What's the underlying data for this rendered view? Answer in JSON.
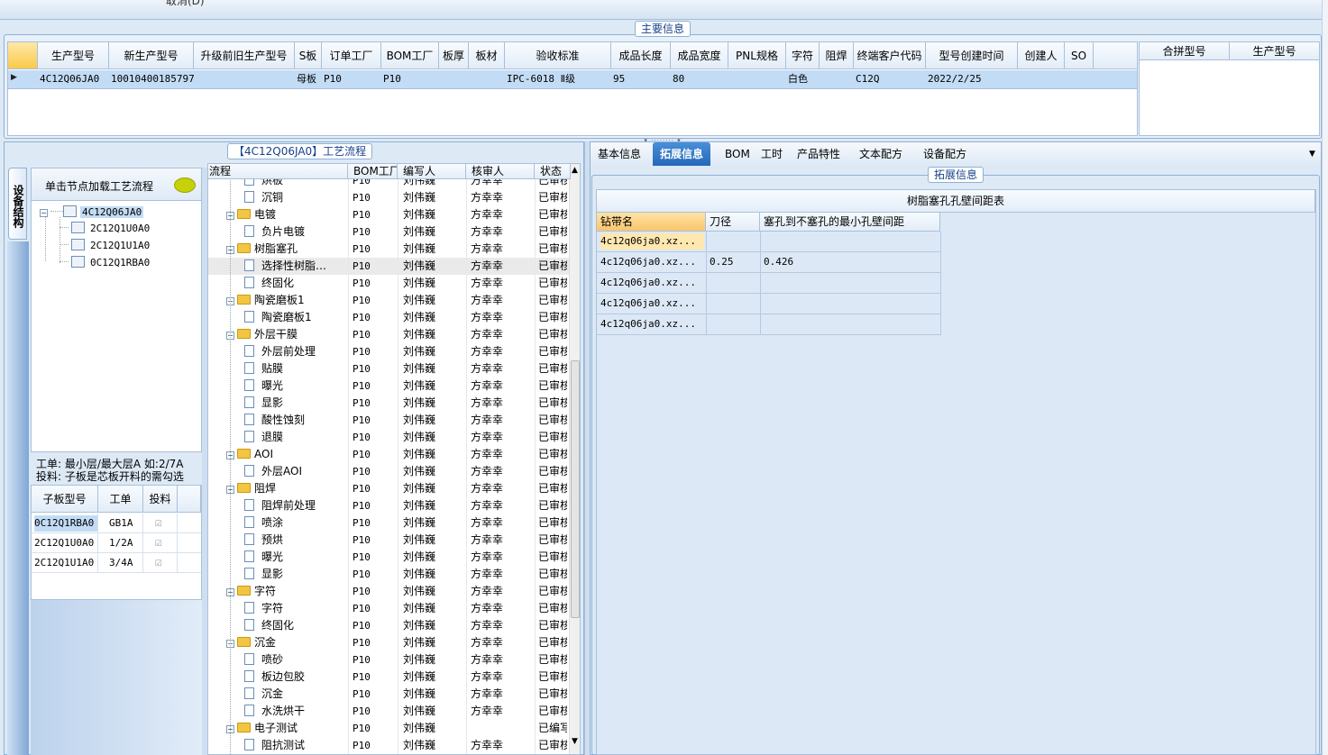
{
  "top_strip": {
    "text": "取消(D)"
  },
  "main_info": {
    "caption": "主要信息",
    "columns": [
      "生产型号",
      "新生产型号",
      "升级前旧生产型号",
      "S板",
      "订单工厂",
      "BOM工厂",
      "板厚",
      "板材",
      "验收标准",
      "成品长度",
      "成品宽度",
      "PNL规格",
      "字符",
      "阻焊",
      "终端客户代码",
      "型号创建时间",
      "创建人",
      "SO"
    ],
    "row": [
      "4C12Q06JA0",
      "10010400185797",
      "",
      "母板",
      "P10",
      "P10",
      "",
      "",
      "IPC-6018 Ⅱ级",
      "95",
      "80",
      "",
      "白色",
      "",
      "C12Q",
      "2022/2/25",
      "",
      ""
    ],
    "side_columns": [
      "合拼型号",
      "生产型号"
    ]
  },
  "left_panel": {
    "vertical_tab": "设备结构",
    "hint": "单击节点加载工艺流程",
    "tree": {
      "root": "4C12Q06JA0",
      "children": [
        "2C12Q1U0A0",
        "2C12Q1U1A0",
        "0C12Q1RBA0"
      ]
    },
    "note1": "工单: 最小层/最大层A 如:2/7A",
    "note2": "投料: 子板是芯板开料的需勾选",
    "sub_table": {
      "columns": [
        "子板型号",
        "工单",
        "投料"
      ],
      "rows": [
        {
          "model": "0C12Q1RBA0",
          "order": "GB1A",
          "feed": "☑"
        },
        {
          "model": "2C12Q1U0A0",
          "order": "1/2A",
          "feed": "☑"
        },
        {
          "model": "2C12Q1U1A0",
          "order": "3/4A",
          "feed": "☑"
        }
      ]
    }
  },
  "process": {
    "caption": "【4C12Q06JA0】工艺流程",
    "columns": [
      "流程",
      "BOM工厂",
      "编写人",
      "核审人",
      "状态"
    ],
    "rows": [
      {
        "name": "烘板",
        "type": "doc",
        "bom": "P10",
        "writer": "刘伟巍",
        "reviewer": "方幸幸",
        "status": "已审核"
      },
      {
        "name": "沉铜",
        "type": "doc",
        "bom": "P10",
        "writer": "刘伟巍",
        "reviewer": "方幸幸",
        "status": "已审核"
      },
      {
        "name": "电镀",
        "type": "folder",
        "bom": "P10",
        "writer": "刘伟巍",
        "reviewer": "方幸幸",
        "status": "已审核"
      },
      {
        "name": "负片电镀",
        "type": "doc",
        "bom": "P10",
        "writer": "刘伟巍",
        "reviewer": "方幸幸",
        "status": "已审核"
      },
      {
        "name": "树脂塞孔",
        "type": "folder",
        "bom": "P10",
        "writer": "刘伟巍",
        "reviewer": "方幸幸",
        "status": "已审核"
      },
      {
        "name": "选择性树脂…",
        "type": "doc",
        "bom": "P10",
        "writer": "刘伟巍",
        "reviewer": "方幸幸",
        "status": "已审核"
      },
      {
        "name": "终固化",
        "type": "doc",
        "bom": "P10",
        "writer": "刘伟巍",
        "reviewer": "方幸幸",
        "status": "已审核"
      },
      {
        "name": "陶瓷磨板1",
        "type": "folder",
        "bom": "P10",
        "writer": "刘伟巍",
        "reviewer": "方幸幸",
        "status": "已审核"
      },
      {
        "name": "陶瓷磨板1",
        "type": "doc",
        "bom": "P10",
        "writer": "刘伟巍",
        "reviewer": "方幸幸",
        "status": "已审核"
      },
      {
        "name": "外层干膜",
        "type": "folder",
        "bom": "P10",
        "writer": "刘伟巍",
        "reviewer": "方幸幸",
        "status": "已审核"
      },
      {
        "name": "外层前处理",
        "type": "doc",
        "bom": "P10",
        "writer": "刘伟巍",
        "reviewer": "方幸幸",
        "status": "已审核"
      },
      {
        "name": "贴膜",
        "type": "doc",
        "bom": "P10",
        "writer": "刘伟巍",
        "reviewer": "方幸幸",
        "status": "已审核"
      },
      {
        "name": "曝光",
        "type": "doc",
        "bom": "P10",
        "writer": "刘伟巍",
        "reviewer": "方幸幸",
        "status": "已审核"
      },
      {
        "name": "显影",
        "type": "doc",
        "bom": "P10",
        "writer": "刘伟巍",
        "reviewer": "方幸幸",
        "status": "已审核"
      },
      {
        "name": "酸性蚀刻",
        "type": "doc",
        "bom": "P10",
        "writer": "刘伟巍",
        "reviewer": "方幸幸",
        "status": "已审核"
      },
      {
        "name": "退膜",
        "type": "doc",
        "bom": "P10",
        "writer": "刘伟巍",
        "reviewer": "方幸幸",
        "status": "已审核"
      },
      {
        "name": "AOI",
        "type": "folder",
        "bom": "P10",
        "writer": "刘伟巍",
        "reviewer": "方幸幸",
        "status": "已审核"
      },
      {
        "name": "外层AOI",
        "type": "doc",
        "bom": "P10",
        "writer": "刘伟巍",
        "reviewer": "方幸幸",
        "status": "已审核"
      },
      {
        "name": "阻焊",
        "type": "folder",
        "bom": "P10",
        "writer": "刘伟巍",
        "reviewer": "方幸幸",
        "status": "已审核"
      },
      {
        "name": "阻焊前处理",
        "type": "doc",
        "bom": "P10",
        "writer": "刘伟巍",
        "reviewer": "方幸幸",
        "status": "已审核"
      },
      {
        "name": "喷涂",
        "type": "doc",
        "bom": "P10",
        "writer": "刘伟巍",
        "reviewer": "方幸幸",
        "status": "已审核"
      },
      {
        "name": "预烘",
        "type": "doc",
        "bom": "P10",
        "writer": "刘伟巍",
        "reviewer": "方幸幸",
        "status": "已审核"
      },
      {
        "name": "曝光",
        "type": "doc",
        "bom": "P10",
        "writer": "刘伟巍",
        "reviewer": "方幸幸",
        "status": "已审核"
      },
      {
        "name": "显影",
        "type": "doc",
        "bom": "P10",
        "writer": "刘伟巍",
        "reviewer": "方幸幸",
        "status": "已审核"
      },
      {
        "name": "字符",
        "type": "folder",
        "bom": "P10",
        "writer": "刘伟巍",
        "reviewer": "方幸幸",
        "status": "已审核"
      },
      {
        "name": "字符",
        "type": "doc",
        "bom": "P10",
        "writer": "刘伟巍",
        "reviewer": "方幸幸",
        "status": "已审核"
      },
      {
        "name": "终固化",
        "type": "doc",
        "bom": "P10",
        "writer": "刘伟巍",
        "reviewer": "方幸幸",
        "status": "已审核"
      },
      {
        "name": "沉金",
        "type": "folder",
        "bom": "P10",
        "writer": "刘伟巍",
        "reviewer": "方幸幸",
        "status": "已审核"
      },
      {
        "name": "喷砂",
        "type": "doc",
        "bom": "P10",
        "writer": "刘伟巍",
        "reviewer": "方幸幸",
        "status": "已审核"
      },
      {
        "name": "板边包胶",
        "type": "doc",
        "bom": "P10",
        "writer": "刘伟巍",
        "reviewer": "方幸幸",
        "status": "已审核"
      },
      {
        "name": "沉金",
        "type": "doc",
        "bom": "P10",
        "writer": "刘伟巍",
        "reviewer": "方幸幸",
        "status": "已审核"
      },
      {
        "name": "水洗烘干",
        "type": "doc",
        "bom": "P10",
        "writer": "刘伟巍",
        "reviewer": "方幸幸",
        "status": "已审核"
      },
      {
        "name": "电子测试",
        "type": "folder",
        "bom": "P10",
        "writer": "刘伟巍",
        "reviewer": "",
        "status": "已编写"
      },
      {
        "name": "阻抗测试",
        "type": "doc",
        "bom": "P10",
        "writer": "刘伟巍",
        "reviewer": "方幸幸",
        "status": "已审核"
      }
    ]
  },
  "right_tabs": [
    "基本信息",
    "拓展信息",
    "BOM",
    "工时",
    "产品特性",
    "文本配方",
    "设备配方"
  ],
  "right_tabs_active": 1,
  "ext": {
    "caption": "拓展信息",
    "table_title": "树脂塞孔孔壁间距表",
    "columns": [
      "钻带名",
      "刀径",
      "塞孔到不塞孔的最小孔壁间距"
    ],
    "rows": [
      [
        "4c12q06ja0.xz...",
        "",
        ""
      ],
      [
        "4c12q06ja0.xz...",
        "0.25",
        "0.426"
      ],
      [
        "4c12q06ja0.xz...",
        "",
        ""
      ],
      [
        "4c12q06ja0.xz...",
        "",
        ""
      ],
      [
        "4c12q06ja0.xz...",
        "",
        ""
      ]
    ]
  }
}
